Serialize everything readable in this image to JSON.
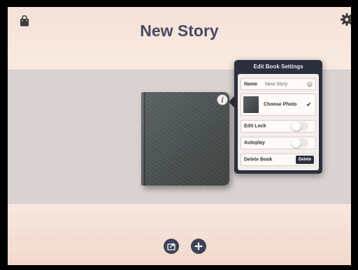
{
  "header": {
    "title": "New Story"
  },
  "book": {
    "info_icon_glyph": "i"
  },
  "popover": {
    "title": "Edit Book Settings",
    "name_label": "Name",
    "name_value": "New Story",
    "choose_photo_label": "Choose Photo",
    "edit_lock_label": "Edit Lock",
    "edit_lock_on": false,
    "autoplay_label": "Autoplay",
    "autoplay_on": false,
    "delete_book_label": "Delete Book",
    "delete_button_label": "Delete"
  },
  "icons": {
    "top_left": "shopping-bag-icon",
    "top_right": "gear-icon",
    "bottom_left": "export-icon",
    "bottom_right": "add-icon"
  },
  "colors": {
    "title_text": "#4b4a64",
    "popover_bg": "#2b2f3e",
    "button_bg": "#3e4356"
  }
}
